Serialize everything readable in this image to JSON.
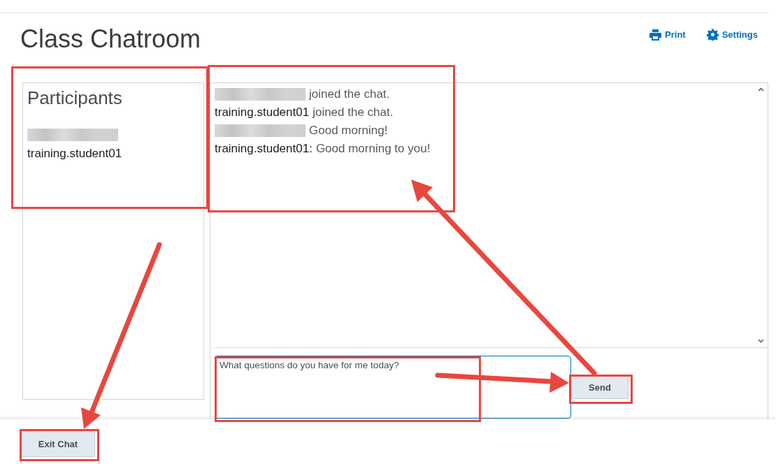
{
  "page": {
    "title": "Class Chatroom"
  },
  "header_links": [
    {
      "kind": "print",
      "label": "Print"
    },
    {
      "kind": "settings",
      "label": "Settings"
    }
  ],
  "participants": {
    "heading": "Participants",
    "items": [
      {
        "redacted": true
      },
      {
        "redacted": false,
        "name": "training.student01"
      }
    ]
  },
  "messages": [
    {
      "redacted": true,
      "text": "joined the chat."
    },
    {
      "redacted": false,
      "sender": "training.student01",
      "text": "joined the chat."
    },
    {
      "redacted": true,
      "text": "Good morning!"
    },
    {
      "redacted": false,
      "sender": "training.student01:",
      "text": "Good morning to you!"
    }
  ],
  "composer": {
    "value": "What questions do you have for me today?",
    "send_label": "Send"
  },
  "footer": {
    "exit_label": "Exit Chat"
  }
}
